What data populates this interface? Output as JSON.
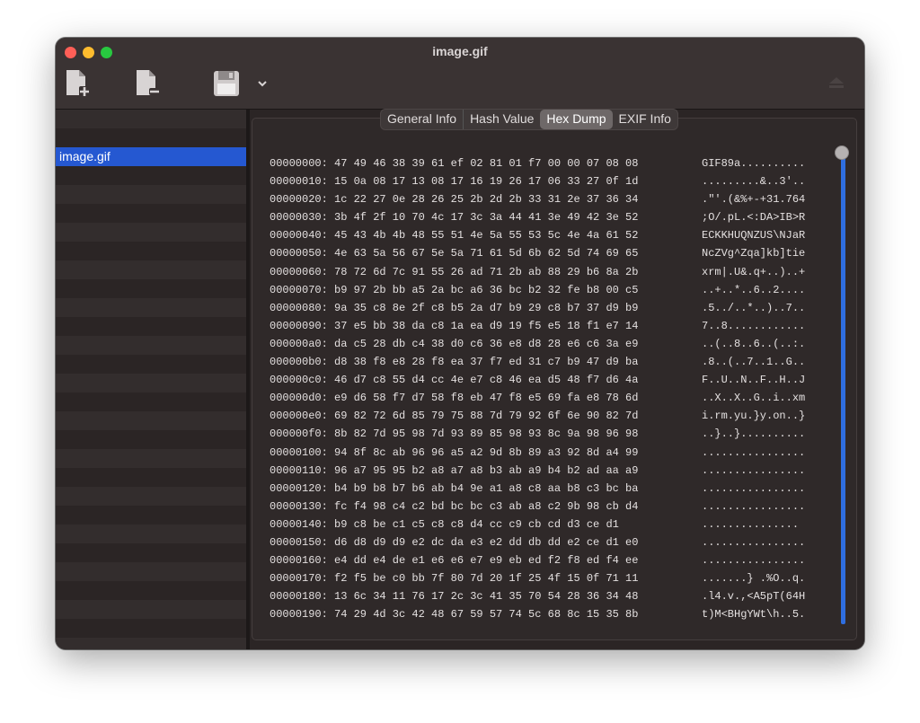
{
  "window": {
    "title": "image.gif"
  },
  "toolbar": {
    "add_icon": "add-file-icon",
    "remove_icon": "remove-file-icon",
    "save_icon": "floppy-disk-icon",
    "menu_icon": "chevron-down-icon",
    "upload_icon": "eject-icon"
  },
  "sidebar": {
    "items": [
      {
        "label": "image.gif",
        "selected": true
      }
    ]
  },
  "tabs": [
    {
      "label": "General Info",
      "active": false
    },
    {
      "label": "Hash Value",
      "active": false
    },
    {
      "label": "Hex Dump",
      "active": true
    },
    {
      "label": "EXIF Info",
      "active": false
    }
  ],
  "hexdump": [
    {
      "addr": "00000000:",
      "hex": "47 49 46 38 39 61 ef 02 81 01 f7 00 00 07 08 08",
      "ascii": "GIF89a.........."
    },
    {
      "addr": "00000010:",
      "hex": "15 0a 08 17 13 08 17 16 19 26 17 06 33 27 0f 1d",
      "ascii": ".........&..3'.."
    },
    {
      "addr": "00000020:",
      "hex": "1c 22 27 0e 28 26 25 2b 2d 2b 33 31 2e 37 36 34",
      "ascii": ".\"'.(&%+-+31.764"
    },
    {
      "addr": "00000030:",
      "hex": "3b 4f 2f 10 70 4c 17 3c 3a 44 41 3e 49 42 3e 52",
      "ascii": ";O/.pL.<:DA>IB>R"
    },
    {
      "addr": "00000040:",
      "hex": "45 43 4b 4b 48 55 51 4e 5a 55 53 5c 4e 4a 61 52",
      "ascii": "ECKKHUQNZUS\\NJaR"
    },
    {
      "addr": "00000050:",
      "hex": "4e 63 5a 56 67 5e 5a 71 61 5d 6b 62 5d 74 69 65",
      "ascii": "NcZVg^Zqa]kb]tie"
    },
    {
      "addr": "00000060:",
      "hex": "78 72 6d 7c 91 55 26 ad 71 2b ab 88 29 b6 8a 2b",
      "ascii": "xrm|.U&.q+..)..+"
    },
    {
      "addr": "00000070:",
      "hex": "b9 97 2b bb a5 2a bc a6 36 bc b2 32 fe b8 00 c5",
      "ascii": "..+..*..6..2...."
    },
    {
      "addr": "00000080:",
      "hex": "9a 35 c8 8e 2f c8 b5 2a d7 b9 29 c8 b7 37 d9 b9",
      "ascii": ".5../..*..)..7.."
    },
    {
      "addr": "00000090:",
      "hex": "37 e5 bb 38 da c8 1a ea d9 19 f5 e5 18 f1 e7 14",
      "ascii": "7..8............"
    },
    {
      "addr": "000000a0:",
      "hex": "da c5 28 db c4 38 d0 c6 36 e8 d8 28 e6 c6 3a e9",
      "ascii": "..(..8..6..(..:."
    },
    {
      "addr": "000000b0:",
      "hex": "d8 38 f8 e8 28 f8 ea 37 f7 ed 31 c7 b9 47 d9 ba",
      "ascii": ".8..(..7..1..G.."
    },
    {
      "addr": "000000c0:",
      "hex": "46 d7 c8 55 d4 cc 4e e7 c8 46 ea d5 48 f7 d6 4a",
      "ascii": "F..U..N..F..H..J"
    },
    {
      "addr": "000000d0:",
      "hex": "e9 d6 58 f7 d7 58 f8 eb 47 f8 e5 69 fa e8 78 6d",
      "ascii": "..X..X..G..i..xm"
    },
    {
      "addr": "000000e0:",
      "hex": "69 82 72 6d 85 79 75 88 7d 79 92 6f 6e 90 82 7d",
      "ascii": "i.rm.yu.}y.on..}"
    },
    {
      "addr": "000000f0:",
      "hex": "8b 82 7d 95 98 7d 93 89 85 98 93 8c 9a 98 96 98",
      "ascii": "..}..}.........."
    },
    {
      "addr": "00000100:",
      "hex": "94 8f 8c ab 96 96 a5 a2 9d 8b 89 a3 92 8d a4 99",
      "ascii": "................"
    },
    {
      "addr": "00000110:",
      "hex": "96 a7 95 95 b2 a8 a7 a8 b3 ab a9 b4 b2 ad aa a9",
      "ascii": "................"
    },
    {
      "addr": "00000120:",
      "hex": "b4 b9 b8 b7 b6 ab b4 9e a1 a8 c8 aa b8 c3 bc ba",
      "ascii": "................"
    },
    {
      "addr": "00000130:",
      "hex": "fc f4 98 c4 c2 bd bc bc c3 ab a8 c2 9b 98 cb d4",
      "ascii": "................"
    },
    {
      "addr": "00000140:",
      "hex": "b9 c8 be c1 c5 c8 c8 d4 cc c9 cb cd d3 ce d1",
      "ascii": "..............."
    },
    {
      "addr": "00000150:",
      "hex": "d6 d8 d9 d9 e2 dc da e3 e2 dd db dd e2 ce d1 e0",
      "ascii": "................"
    },
    {
      "addr": "00000160:",
      "hex": "e4 dd e4 de e1 e6 e6 e7 e9 eb ed f2 f8 ed f4 ee",
      "ascii": "................"
    },
    {
      "addr": "00000170:",
      "hex": "f2 f5 be c0 bb 7f 80 7d 20 1f 25 4f 15 0f 71 11",
      "ascii": ".......} .%O..q."
    },
    {
      "addr": "00000180:",
      "hex": "13 6c 34 11 76 17 2c 3c 41 35 70 54 28 36 34 48",
      "ascii": ".l4.v.,<A5pT(64H"
    },
    {
      "addr": "00000190:",
      "hex": "74 29 4d 3c 42 48 67 59 57 74 5c 68 8c 15 35 8b",
      "ascii": "t)M<BHgYWt\\h..5."
    }
  ]
}
